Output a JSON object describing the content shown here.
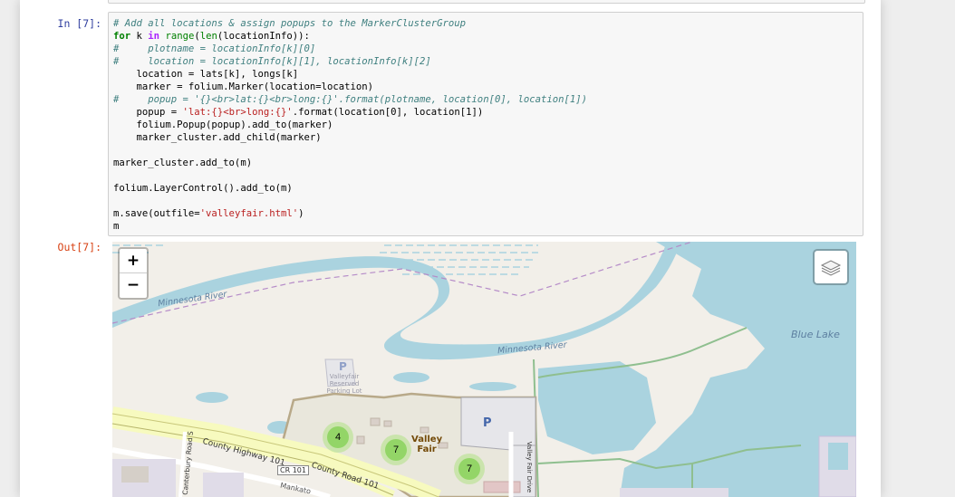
{
  "notebook": {
    "in_prompt": "In [7]:",
    "out_prompt": "Out[7]:",
    "code_lines": [
      "# Add all locations & assign popups to the MarkerClusterGroup",
      "for k in range(len(locationInfo)):",
      "#     plotname = locationInfo[k][0]",
      "#     location = locationInfo[k][1], locationInfo[k][2]",
      "    location = lats[k], longs[k]",
      "    marker = folium.Marker(location=location)",
      "#     popup = '{}<br>lat:{}<br>long:{}'.format(plotname, location[0], location[1])",
      "    popup = 'lat:{}<br>long:{}'.format(location[0], location[1])",
      "    folium.Popup(popup).add_to(marker)",
      "    marker_cluster.add_child(marker)",
      "",
      "marker_cluster.add_to(m)",
      "",
      "folium.LayerControl().add_to(m)",
      "",
      "m.save(outfile='valleyfair.html')",
      "m"
    ]
  },
  "map": {
    "zoom_in": "+",
    "zoom_out": "−",
    "layers_icon": "layers-icon",
    "clusters": [
      {
        "count": "4"
      },
      {
        "count": "7"
      },
      {
        "count": "7"
      }
    ],
    "labels": {
      "river_left": "Minnesota River",
      "river_right": "Minnesota River",
      "blue_lake": "Blue Lake",
      "valley_fair_line1": "Valley",
      "valley_fair_line2": "Fair",
      "county_highway": "County Highway 101",
      "cr101": "CR 101",
      "county_road": "County Road 101",
      "canterbury_road": "Canterbury Road S",
      "valley_fair_drive": "Valley Fair Drive",
      "mankato": "Mankato",
      "parking_p": "P",
      "parking_lot_label": "Valleyfair Reserved Parking Lot"
    },
    "colors": {
      "water": "#aad3df",
      "land": "#f2efe9",
      "cluster_outer": "#b5e28c",
      "cluster_inner": "#6ecc39"
    }
  }
}
